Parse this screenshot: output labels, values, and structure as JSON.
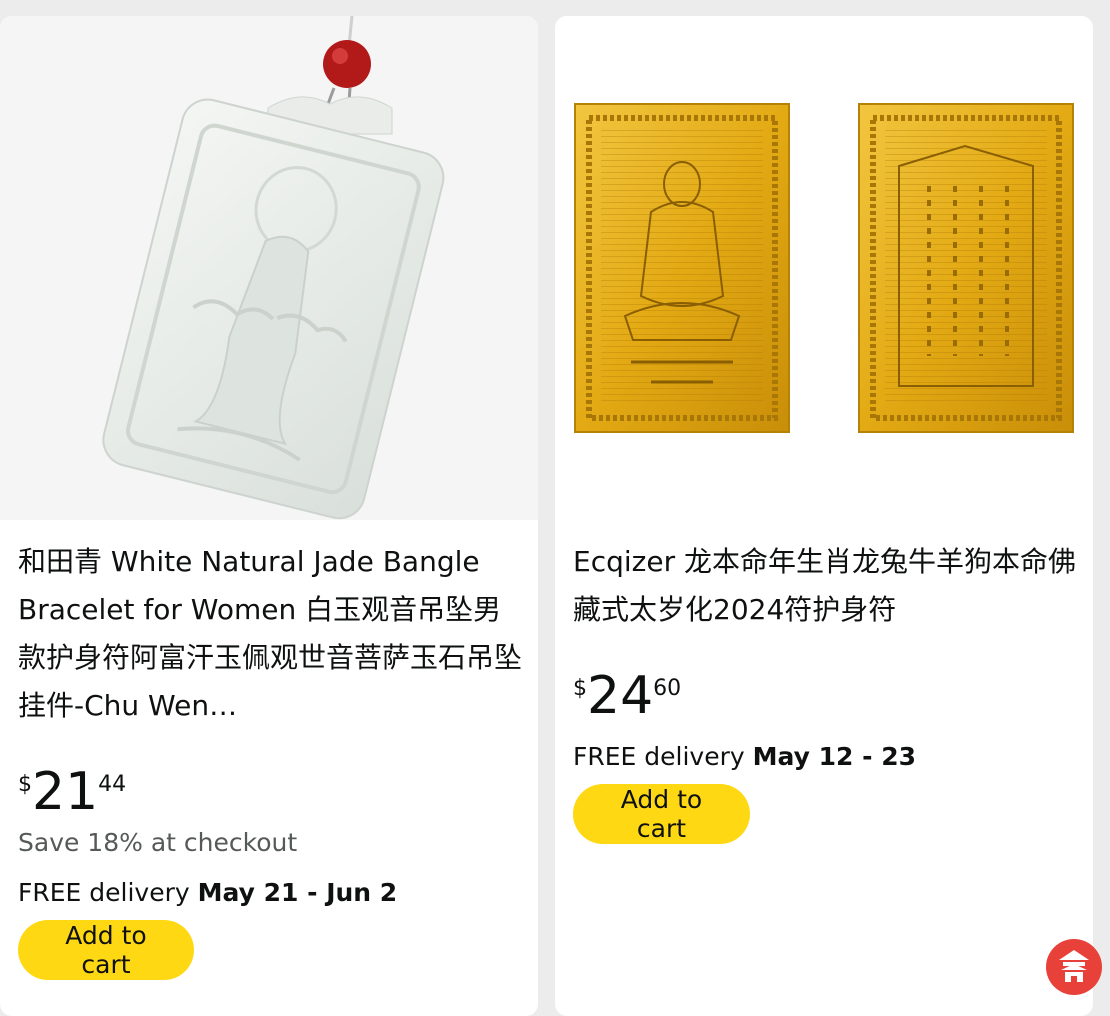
{
  "products": [
    {
      "title": "和田青 White Natural Jade Bangle Bracelet for Women 白玉观音吊坠男款护身符阿富汗玉佩观世音菩萨玉石吊坠挂件-Chu Wen…",
      "price": {
        "symbol": "$",
        "whole": "21",
        "fraction": "44"
      },
      "save_text": "Save 18% at checkout",
      "delivery_prefix": "FREE delivery ",
      "delivery_dates": "May 21 - Jun 2",
      "cart_label": "Add to cart",
      "image": "white-jade-guanyin-pendant"
    },
    {
      "title": "Ecqizer 龙本命年生肖龙兔牛羊狗本命佛藏式太岁化2024符护身符",
      "price": {
        "symbol": "$",
        "whole": "24",
        "fraction": "60"
      },
      "delivery_prefix": "FREE delivery ",
      "delivery_dates": "May 12 - 23",
      "cart_label": "Add to cart",
      "image": "gold-buddha-amulet-cards"
    }
  ],
  "colors": {
    "cart_button": "#ffd814",
    "page_bg": "#ececec",
    "card_bg": "#ffffff",
    "gold": "#e0a815"
  },
  "watermark": {
    "icon": "pavilion-logo"
  }
}
